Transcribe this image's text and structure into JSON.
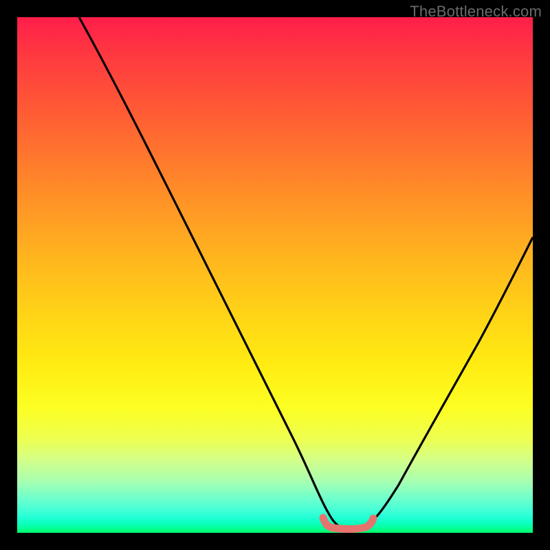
{
  "watermark": "TheBottleneck.com",
  "colors": {
    "background": "#000000",
    "gradient_top": "#ff1e4a",
    "gradient_bottom": "#00ff66",
    "curve": "#000000",
    "highlight_segment": "#e6736e"
  },
  "chart_data": {
    "type": "line",
    "title": "",
    "xlabel": "",
    "ylabel": "",
    "xlim": [
      0,
      100
    ],
    "ylim": [
      0,
      100
    ],
    "grid": false,
    "legend": false,
    "description": "Single black V-shaped curve over a vertical red→yellow→green gradient; a short horizontal pale-red segment sits at the curve trough. No axis ticks or labels are visible.",
    "series": [
      {
        "name": "curve",
        "x": [
          12,
          16,
          20,
          25,
          30,
          35,
          40,
          45,
          50,
          55,
          58,
          59,
          60,
          62,
          64,
          67,
          70,
          75,
          80,
          85,
          90,
          95,
          100
        ],
        "values": [
          100,
          93,
          86,
          77.5,
          69,
          60.5,
          51.5,
          42,
          31.5,
          19,
          9.5,
          6,
          3.5,
          1.8,
          1.2,
          1.5,
          3.5,
          9,
          17,
          28,
          41,
          54,
          66
        ]
      }
    ],
    "highlight_segment": {
      "name": "trough-marker",
      "x_start": 59,
      "x_end": 69,
      "y": 1.2
    }
  }
}
